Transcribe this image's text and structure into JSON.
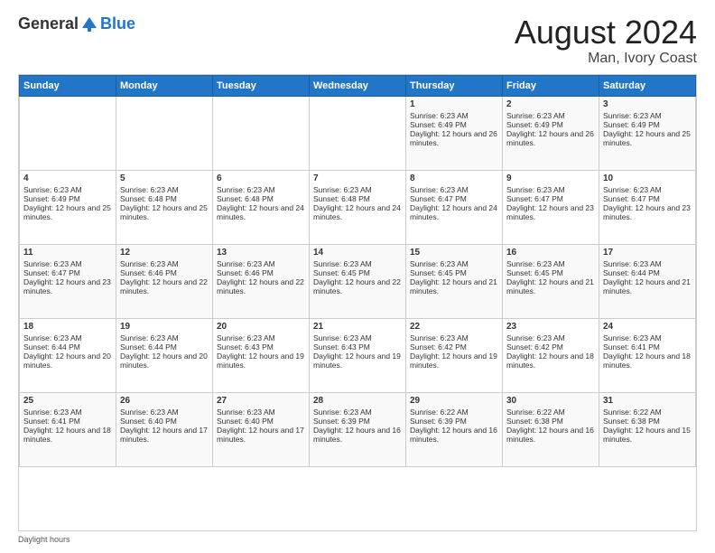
{
  "header": {
    "logo_general": "General",
    "logo_blue": "Blue",
    "month_year": "August 2024",
    "location": "Man, Ivory Coast"
  },
  "days_of_week": [
    "Sunday",
    "Monday",
    "Tuesday",
    "Wednesday",
    "Thursday",
    "Friday",
    "Saturday"
  ],
  "weeks": [
    [
      {
        "day": "",
        "text": ""
      },
      {
        "day": "",
        "text": ""
      },
      {
        "day": "",
        "text": ""
      },
      {
        "day": "",
        "text": ""
      },
      {
        "day": "1",
        "text": "Sunrise: 6:23 AM\nSunset: 6:49 PM\nDaylight: 12 hours and 26 minutes."
      },
      {
        "day": "2",
        "text": "Sunrise: 6:23 AM\nSunset: 6:49 PM\nDaylight: 12 hours and 26 minutes."
      },
      {
        "day": "3",
        "text": "Sunrise: 6:23 AM\nSunset: 6:49 PM\nDaylight: 12 hours and 25 minutes."
      }
    ],
    [
      {
        "day": "4",
        "text": "Sunrise: 6:23 AM\nSunset: 6:49 PM\nDaylight: 12 hours and 25 minutes."
      },
      {
        "day": "5",
        "text": "Sunrise: 6:23 AM\nSunset: 6:48 PM\nDaylight: 12 hours and 25 minutes."
      },
      {
        "day": "6",
        "text": "Sunrise: 6:23 AM\nSunset: 6:48 PM\nDaylight: 12 hours and 24 minutes."
      },
      {
        "day": "7",
        "text": "Sunrise: 6:23 AM\nSunset: 6:48 PM\nDaylight: 12 hours and 24 minutes."
      },
      {
        "day": "8",
        "text": "Sunrise: 6:23 AM\nSunset: 6:47 PM\nDaylight: 12 hours and 24 minutes."
      },
      {
        "day": "9",
        "text": "Sunrise: 6:23 AM\nSunset: 6:47 PM\nDaylight: 12 hours and 23 minutes."
      },
      {
        "day": "10",
        "text": "Sunrise: 6:23 AM\nSunset: 6:47 PM\nDaylight: 12 hours and 23 minutes."
      }
    ],
    [
      {
        "day": "11",
        "text": "Sunrise: 6:23 AM\nSunset: 6:47 PM\nDaylight: 12 hours and 23 minutes."
      },
      {
        "day": "12",
        "text": "Sunrise: 6:23 AM\nSunset: 6:46 PM\nDaylight: 12 hours and 22 minutes."
      },
      {
        "day": "13",
        "text": "Sunrise: 6:23 AM\nSunset: 6:46 PM\nDaylight: 12 hours and 22 minutes."
      },
      {
        "day": "14",
        "text": "Sunrise: 6:23 AM\nSunset: 6:45 PM\nDaylight: 12 hours and 22 minutes."
      },
      {
        "day": "15",
        "text": "Sunrise: 6:23 AM\nSunset: 6:45 PM\nDaylight: 12 hours and 21 minutes."
      },
      {
        "day": "16",
        "text": "Sunrise: 6:23 AM\nSunset: 6:45 PM\nDaylight: 12 hours and 21 minutes."
      },
      {
        "day": "17",
        "text": "Sunrise: 6:23 AM\nSunset: 6:44 PM\nDaylight: 12 hours and 21 minutes."
      }
    ],
    [
      {
        "day": "18",
        "text": "Sunrise: 6:23 AM\nSunset: 6:44 PM\nDaylight: 12 hours and 20 minutes."
      },
      {
        "day": "19",
        "text": "Sunrise: 6:23 AM\nSunset: 6:44 PM\nDaylight: 12 hours and 20 minutes."
      },
      {
        "day": "20",
        "text": "Sunrise: 6:23 AM\nSunset: 6:43 PM\nDaylight: 12 hours and 19 minutes."
      },
      {
        "day": "21",
        "text": "Sunrise: 6:23 AM\nSunset: 6:43 PM\nDaylight: 12 hours and 19 minutes."
      },
      {
        "day": "22",
        "text": "Sunrise: 6:23 AM\nSunset: 6:42 PM\nDaylight: 12 hours and 19 minutes."
      },
      {
        "day": "23",
        "text": "Sunrise: 6:23 AM\nSunset: 6:42 PM\nDaylight: 12 hours and 18 minutes."
      },
      {
        "day": "24",
        "text": "Sunrise: 6:23 AM\nSunset: 6:41 PM\nDaylight: 12 hours and 18 minutes."
      }
    ],
    [
      {
        "day": "25",
        "text": "Sunrise: 6:23 AM\nSunset: 6:41 PM\nDaylight: 12 hours and 18 minutes."
      },
      {
        "day": "26",
        "text": "Sunrise: 6:23 AM\nSunset: 6:40 PM\nDaylight: 12 hours and 17 minutes."
      },
      {
        "day": "27",
        "text": "Sunrise: 6:23 AM\nSunset: 6:40 PM\nDaylight: 12 hours and 17 minutes."
      },
      {
        "day": "28",
        "text": "Sunrise: 6:23 AM\nSunset: 6:39 PM\nDaylight: 12 hours and 16 minutes."
      },
      {
        "day": "29",
        "text": "Sunrise: 6:22 AM\nSunset: 6:39 PM\nDaylight: 12 hours and 16 minutes."
      },
      {
        "day": "30",
        "text": "Sunrise: 6:22 AM\nSunset: 6:38 PM\nDaylight: 12 hours and 16 minutes."
      },
      {
        "day": "31",
        "text": "Sunrise: 6:22 AM\nSunset: 6:38 PM\nDaylight: 12 hours and 15 minutes."
      }
    ]
  ],
  "footer": {
    "daylight_hours": "Daylight hours"
  }
}
